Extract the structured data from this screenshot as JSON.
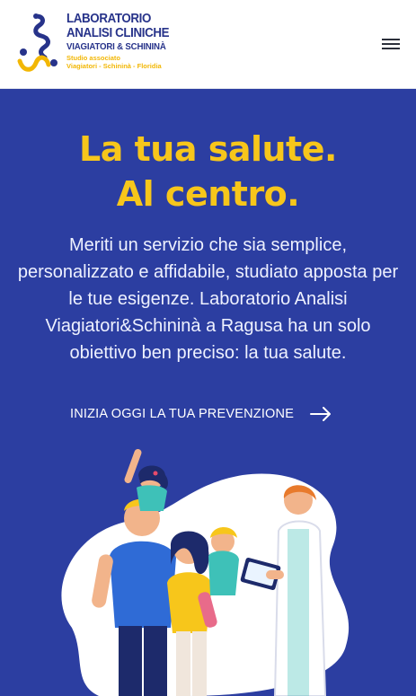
{
  "header": {
    "logo": {
      "line1": "LABORATORIO",
      "line2": "ANALISI CLINICHE",
      "line3": "VIAGIATORI & SCHININÀ",
      "line4": "Studio associato",
      "line5": "Viagiatori - Schininà - Floridia"
    },
    "menu_icon": "hamburger-menu-icon"
  },
  "hero": {
    "title_line1": "La tua salute.",
    "title_line2": "Al centro.",
    "text": "Meriti un servizio che sia semplice, personalizzato e affidabile, studiato apposta per le tue esigenze. Laboratorio Analisi Viagiatori&Schininà a Ragusa ha un solo obiettivo ben preciso: la tua salute.",
    "cta_label": "INIZIA OGGI LA TUA PREVENZIONE",
    "cta_icon": "arrow-right-icon"
  },
  "colors": {
    "brand_blue": "#2c3ea1",
    "brand_yellow": "#f7c61b",
    "logo_blue": "#27338a"
  }
}
